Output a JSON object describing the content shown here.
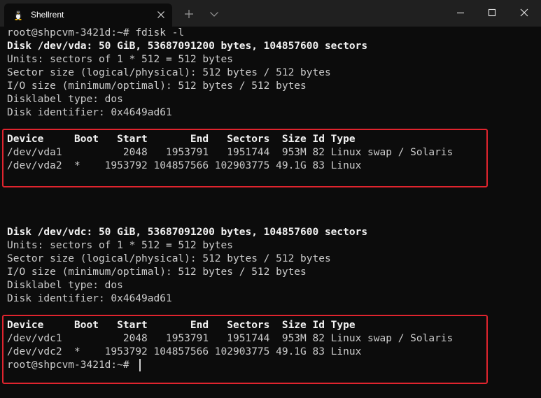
{
  "window": {
    "tab_title": "Shellrent",
    "tab_icon": "linux-penguin-icon"
  },
  "terminal": {
    "lines": [
      "root@shpcvm-3421d:~# fdisk -l",
      "Disk /dev/vda: 50 GiB, 53687091200 bytes, 104857600 sectors",
      "Units: sectors of 1 * 512 = 512 bytes",
      "Sector size (logical/physical): 512 bytes / 512 bytes",
      "I/O size (minimum/optimal): 512 bytes / 512 bytes",
      "Disklabel type: dos",
      "Disk identifier: 0x4649ad61",
      "",
      "Device     Boot   Start       End   Sectors  Size Id Type",
      "/dev/vda1          2048   1953791   1951744  953M 82 Linux swap / Solaris",
      "/dev/vda2  *    1953792 104857566 102903775 49.1G 83 Linux",
      "",
      "",
      "",
      "Disk /dev/vdc: 50 GiB, 53687091200 bytes, 104857600 sectors",
      "Units: sectors of 1 * 512 = 512 bytes",
      "Sector size (logical/physical): 512 bytes / 512 bytes",
      "I/O size (minimum/optimal): 512 bytes / 512 bytes",
      "Disklabel type: dos",
      "Disk identifier: 0x4649ad61",
      "",
      "Device     Boot   Start       End   Sectors  Size Id Type",
      "/dev/vdc1          2048   1953791   1951744  953M 82 Linux swap / Solaris",
      "/dev/vdc2  *    1953792 104857566 102903775 49.1G 83 Linux",
      "root@shpcvm-3421d:~# "
    ]
  },
  "colors": {
    "background": "#0c0c0c",
    "titlebar": "#202020",
    "text": "#cccccc",
    "highlight_border": "#e0242e"
  }
}
